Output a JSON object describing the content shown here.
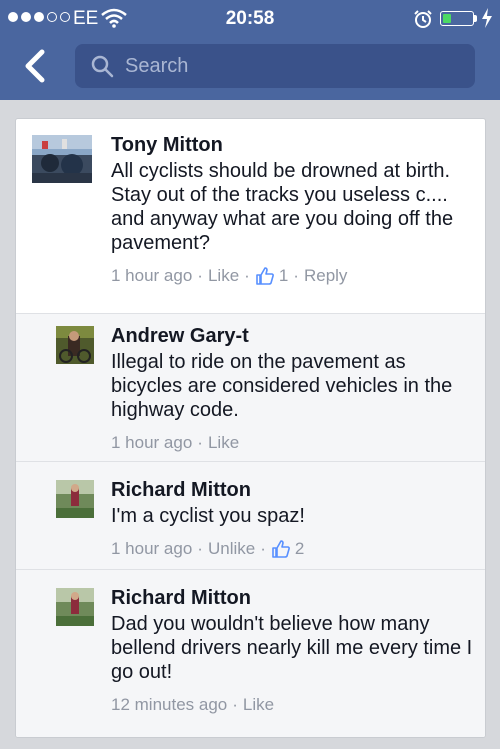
{
  "status_bar": {
    "carrier": "EE",
    "time": "20:58"
  },
  "nav": {
    "search_placeholder": "Search"
  },
  "comments": [
    {
      "author": "Tony Mitton",
      "text": "All cyclists should be drowned at birth. Stay out of the tracks you useless c.... and anyway what are you doing off the pavement?",
      "time": "1 hour ago",
      "like_label": "Like",
      "like_count": "1",
      "reply_label": "Reply",
      "replies": [
        {
          "author": "Andrew Gary-t",
          "text": "Illegal to ride on the pavement as bicycles are considered vehicles in the highway code.",
          "time": "1 hour ago",
          "like_label": "Like"
        },
        {
          "author": "Richard Mitton",
          "text": "I'm a cyclist you spaz!",
          "time": "1 hour ago",
          "like_label": "Unlike",
          "like_count": "2"
        },
        {
          "author": "Richard Mitton",
          "text": "Dad you wouldn't believe how many bellend drivers nearly kill me every time I go out!",
          "time": "12 minutes ago",
          "like_label": "Like"
        }
      ]
    }
  ],
  "colors": {
    "header": "#4a669f",
    "search_box": "#3a528a",
    "meta_text": "#9197a3",
    "like_active": "#5890ff"
  },
  "icons": [
    "wifi-icon",
    "alarm-icon",
    "battery-icon",
    "charging-bolt-icon",
    "back-chevron-icon",
    "search-icon",
    "thumbs-up-icon"
  ]
}
